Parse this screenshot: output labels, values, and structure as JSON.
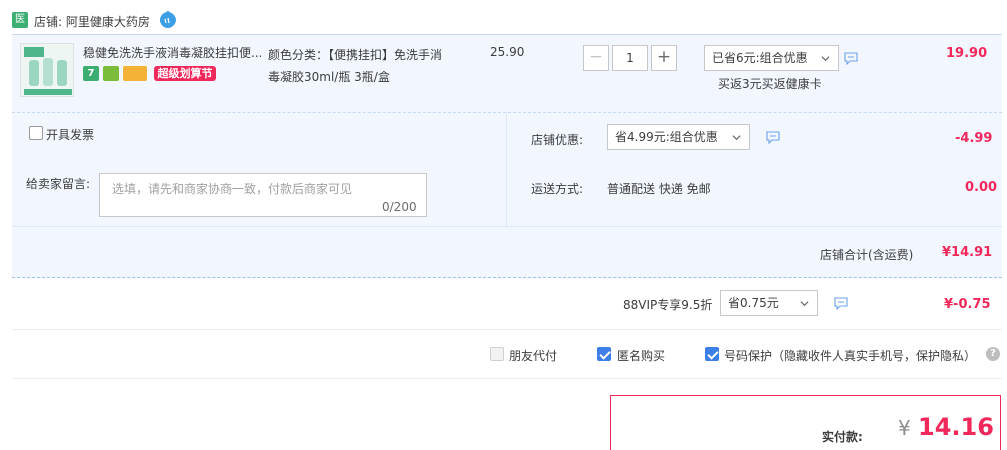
{
  "shop": {
    "badge": "医",
    "label": "店铺: 阿里健康大药房"
  },
  "item": {
    "title": "稳健免洗洗手液消毒凝胶挂扣便...",
    "tag_seven": "7",
    "promo_tag": "超级划算节",
    "sku_line1": "颜色分类：【便携挂扣】免洗手消",
    "sku_line2": "毒凝胶30ml/瓶 3瓶/盒",
    "unit_price": "25.90",
    "qty_minus": "−",
    "qty_plus": "+",
    "quantity": "1",
    "discount_select": "已省6元:组合优惠",
    "promo_note": "买返3元买返健康卡",
    "total": "19.90"
  },
  "invoice": {
    "label": "开具发票",
    "checked": false
  },
  "memo": {
    "label": "给卖家留言:",
    "placeholder": "选填，请先和商家协商一致，付款后商家可见",
    "count": "0/200"
  },
  "shop_discount": {
    "label": "店铺优惠:",
    "select": "省4.99元:组合优惠",
    "amount": "-4.99"
  },
  "shipping": {
    "label": "运送方式:",
    "value": "普通配送 快递 免邮",
    "amount": "0.00"
  },
  "shop_total": {
    "label": "店铺合计(含运费)",
    "amount": "¥14.91"
  },
  "vip": {
    "label": "88VIP专享9.5折",
    "select": "省0.75元",
    "amount": "¥-0.75"
  },
  "options": {
    "friend_pay": {
      "label": "朋友代付",
      "checked": false
    },
    "anonymous": {
      "label": "匿名购买",
      "checked": true
    },
    "phone_protect": {
      "label": "号码保护（隐藏收件人真实手机号，保护隐私）",
      "checked": true
    },
    "help": "?"
  },
  "payment": {
    "label": "实付款:",
    "currency": "¥",
    "amount": "14.16"
  },
  "colors": {
    "accent": "#f1285a",
    "blue": "#3d7fe6",
    "panel": "#f2f7ff"
  },
  "icons": [
    "wangwang-icon",
    "message-icon",
    "chevron-down-icon",
    "help-icon"
  ]
}
